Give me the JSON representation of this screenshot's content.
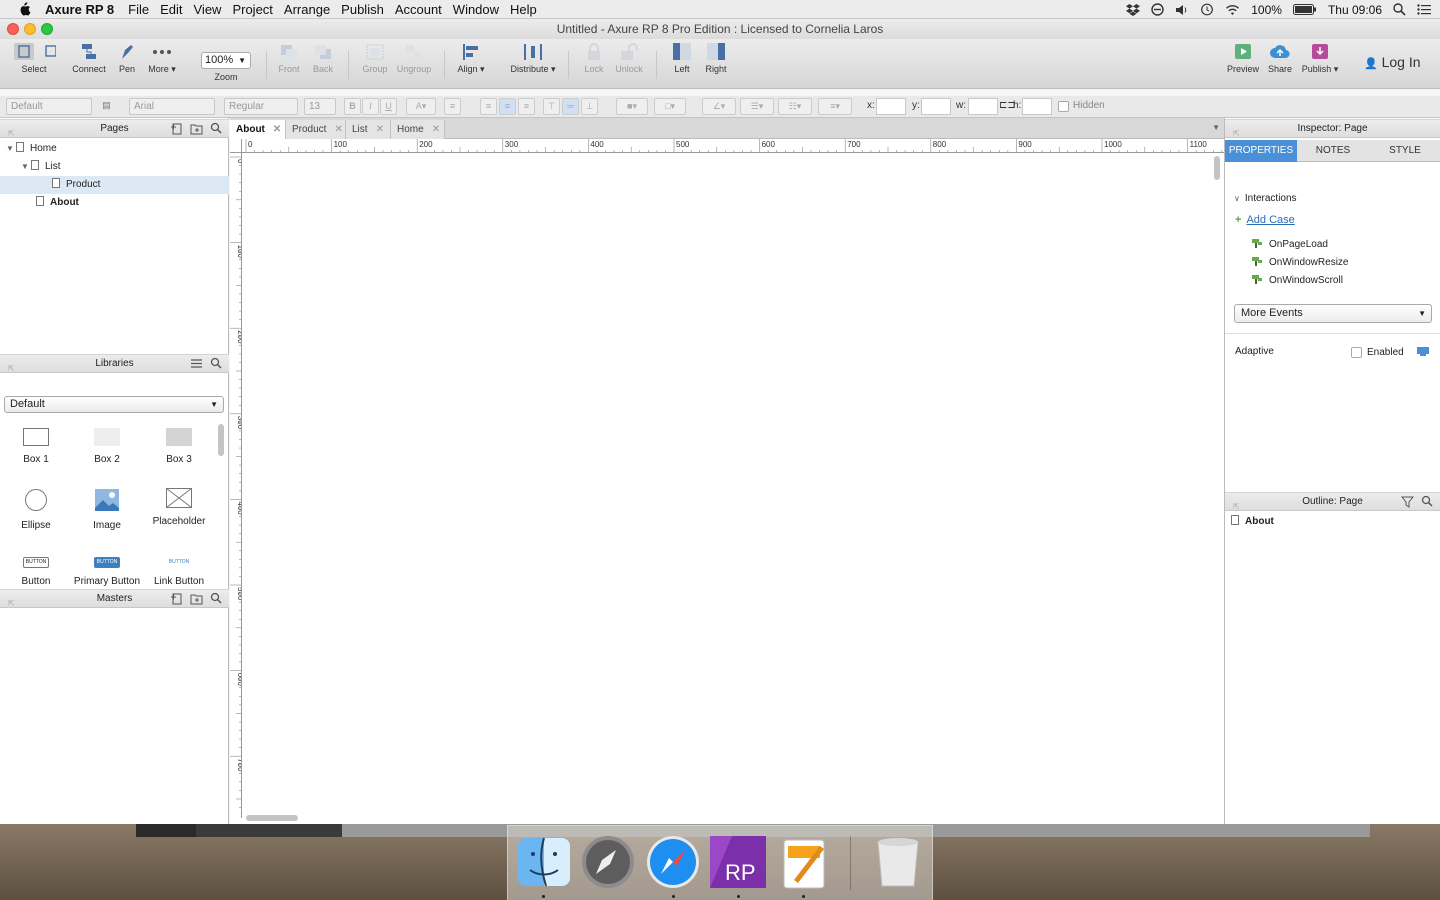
{
  "menubar": {
    "app_name": "Axure RP 8",
    "items": [
      "File",
      "Edit",
      "View",
      "Project",
      "Arrange",
      "Publish",
      "Account",
      "Window",
      "Help"
    ],
    "battery": "100%",
    "clock": "Thu 09:06"
  },
  "window": {
    "title": "Untitled - Axure RP 8 Pro Edition : Licensed to Cornelia Laros"
  },
  "toolbar": {
    "select": "Select",
    "connect": "Connect",
    "pen": "Pen",
    "more": "More ▾",
    "zoom_value": "100%",
    "zoom_label": "Zoom",
    "front": "Front",
    "back": "Back",
    "group": "Group",
    "ungroup": "Ungroup",
    "align": "Align ▾",
    "distribute": "Distribute ▾",
    "lock": "Lock",
    "unlock": "Unlock",
    "left": "Left",
    "right": "Right",
    "preview": "Preview",
    "share": "Share",
    "publish": "Publish ▾",
    "login": "Log In"
  },
  "formatbar": {
    "style": "Default",
    "font": "Arial",
    "weight": "Regular",
    "size": "13",
    "x_label": "x:",
    "y_label": "y:",
    "w_label": "w:",
    "h_label": "h:",
    "hidden_label": "Hidden"
  },
  "pages": {
    "title": "Pages",
    "tree": [
      {
        "label": "Home"
      },
      {
        "label": "List"
      },
      {
        "label": "Product"
      },
      {
        "label": "About"
      }
    ]
  },
  "libraries": {
    "title": "Libraries",
    "selected": "Default",
    "widgets": [
      "Box 1",
      "Box 2",
      "Box 3",
      "Ellipse",
      "Image",
      "Placeholder",
      "Button",
      "Primary Button",
      "Link Button"
    ],
    "button_text": "BUTTON"
  },
  "masters": {
    "title": "Masters"
  },
  "tabs": [
    "About",
    "Product",
    "List",
    "Home"
  ],
  "ruler": {
    "h_ticks": [
      "0",
      "100",
      "200",
      "300",
      "400",
      "500",
      "600",
      "700",
      "800",
      "900",
      "1000",
      "1100"
    ],
    "v_ticks": [
      "0",
      "100",
      "200",
      "300",
      "400",
      "500",
      "600",
      "700"
    ]
  },
  "inspector": {
    "title": "Inspector: Page",
    "tabs": [
      "PROPERTIES",
      "NOTES",
      "STYLE"
    ],
    "interactions_label": "Interactions",
    "add_case": "Add Case",
    "events": [
      "OnPageLoad",
      "OnWindowResize",
      "OnWindowScroll"
    ],
    "more_events": "More Events",
    "adaptive_label": "Adaptive",
    "enabled_label": "Enabled"
  },
  "outline": {
    "title": "Outline: Page",
    "item": "About"
  },
  "colors": {
    "accent": "#4a90d9",
    "selected_row": "#dde8f5",
    "link": "#2a6db5",
    "event_flag": "#6aa84f"
  }
}
